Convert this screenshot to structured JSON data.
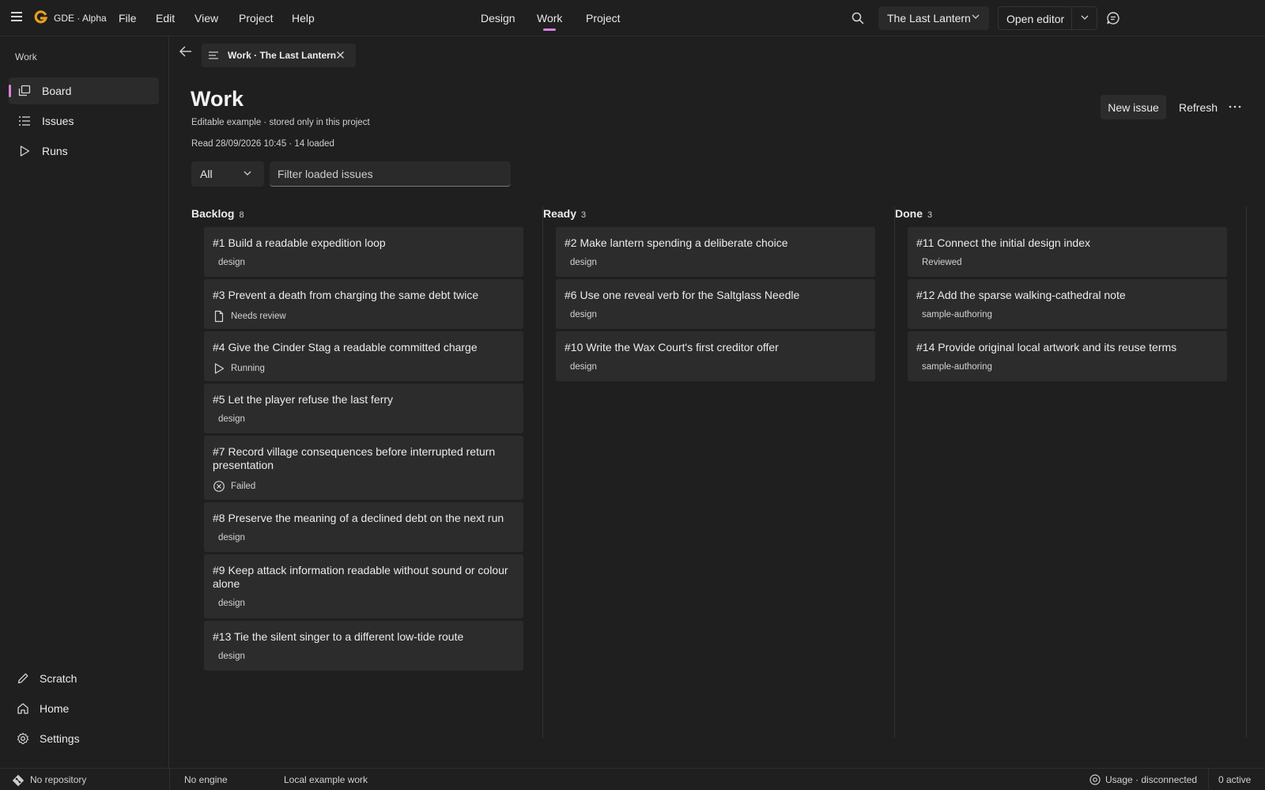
{
  "app": {
    "name": "GDE · Alpha",
    "menu": [
      "File",
      "Edit",
      "View",
      "Project",
      "Help"
    ],
    "nav": [
      "Design",
      "Work",
      "Project"
    ],
    "active_nav": "Work",
    "project_name": "The Last Lantern",
    "open_editor_label": "Open editor",
    "accent": "#d97fe0",
    "logo_color": "#e8a01c"
  },
  "sidebar": {
    "section_label": "Work",
    "items": [
      {
        "label": "Board",
        "icon": "board-icon",
        "active": true
      },
      {
        "label": "Issues",
        "icon": "list-icon"
      },
      {
        "label": "Runs",
        "icon": "play-icon"
      }
    ],
    "bottom_items": [
      {
        "label": "Scratch",
        "icon": "pencil-icon"
      },
      {
        "label": "Home",
        "icon": "home-icon"
      },
      {
        "label": "Settings",
        "icon": "gear-icon"
      }
    ]
  },
  "tab": {
    "label": "Work · The Last Lantern"
  },
  "page": {
    "title": "Work",
    "subtitle": "Editable example · stored only in this project",
    "read_info": "Read 28/09/2026 10:45 · 14 loaded",
    "new_issue_label": "New issue",
    "refresh_label": "Refresh",
    "filter_value": "All",
    "filter_placeholder": "Filter loaded issues"
  },
  "board": {
    "columns": [
      {
        "name": "Backlog",
        "count": "8",
        "cards": [
          {
            "title": "#1 Build a readable expedition loop",
            "meta": "design",
            "icon": ""
          },
          {
            "title": "#3 Prevent a death from charging the same debt twice",
            "meta": "Needs review",
            "icon": "document-icon"
          },
          {
            "title": "#4 Give the Cinder Stag a readable committed charge",
            "meta": "Running",
            "icon": "play-icon"
          },
          {
            "title": "#5 Let the player refuse the last ferry",
            "meta": "design",
            "icon": ""
          },
          {
            "title": "#7 Record village consequences before interrupted return presentation",
            "meta": "Failed",
            "icon": "x-circle-icon"
          },
          {
            "title": "#8 Preserve the meaning of a declined debt on the next run",
            "meta": "design",
            "icon": ""
          },
          {
            "title": "#9 Keep attack information readable without sound or colour alone",
            "meta": "design",
            "icon": ""
          },
          {
            "title": "#13 Tie the silent singer to a different low-tide route",
            "meta": "design",
            "icon": ""
          }
        ]
      },
      {
        "name": "Ready",
        "count": "3",
        "cards": [
          {
            "title": "#2 Make lantern spending a deliberate choice",
            "meta": "design",
            "icon": ""
          },
          {
            "title": "#6 Use one reveal verb for the Saltglass Needle",
            "meta": "design",
            "icon": ""
          },
          {
            "title": "#10 Write the Wax Court's first creditor offer",
            "meta": "design",
            "icon": ""
          }
        ]
      },
      {
        "name": "Done",
        "count": "3",
        "cards": [
          {
            "title": "#11 Connect the initial design index",
            "meta": "Reviewed",
            "icon": ""
          },
          {
            "title": "#12 Add the sparse walking-cathedral note",
            "meta": "sample-authoring",
            "icon": ""
          },
          {
            "title": "#14 Provide original local artwork and its reuse terms",
            "meta": "sample-authoring",
            "icon": ""
          }
        ]
      }
    ]
  },
  "status": {
    "repository": "No repository",
    "engine": "No engine",
    "work_source": "Local example work",
    "usage": "Usage · disconnected",
    "active": "0 active"
  }
}
